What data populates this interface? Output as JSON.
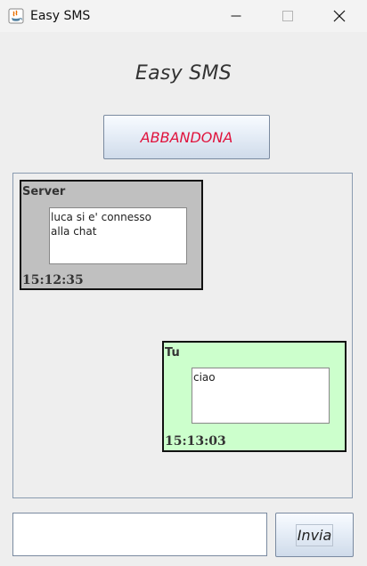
{
  "window": {
    "title": "Easy SMS",
    "icons": {
      "app": "java-icon",
      "minimize": "minimize-icon",
      "maximize": "maximize-icon",
      "close": "close-icon"
    }
  },
  "header": {
    "title": "Easy SMS"
  },
  "actions": {
    "abandon_label": "ABBANDONA",
    "abandon_color": "#e0123c"
  },
  "chat": {
    "messages": [
      {
        "sender": "Server",
        "text": "luca si e' connesso\nalla chat",
        "time": "15:12:35",
        "background": "#c0c0c0"
      },
      {
        "sender": "Tu",
        "text": "ciao",
        "time": "15:13:03",
        "background": "#ccffcc"
      }
    ]
  },
  "composer": {
    "input_value": "",
    "send_label": "Invia"
  }
}
